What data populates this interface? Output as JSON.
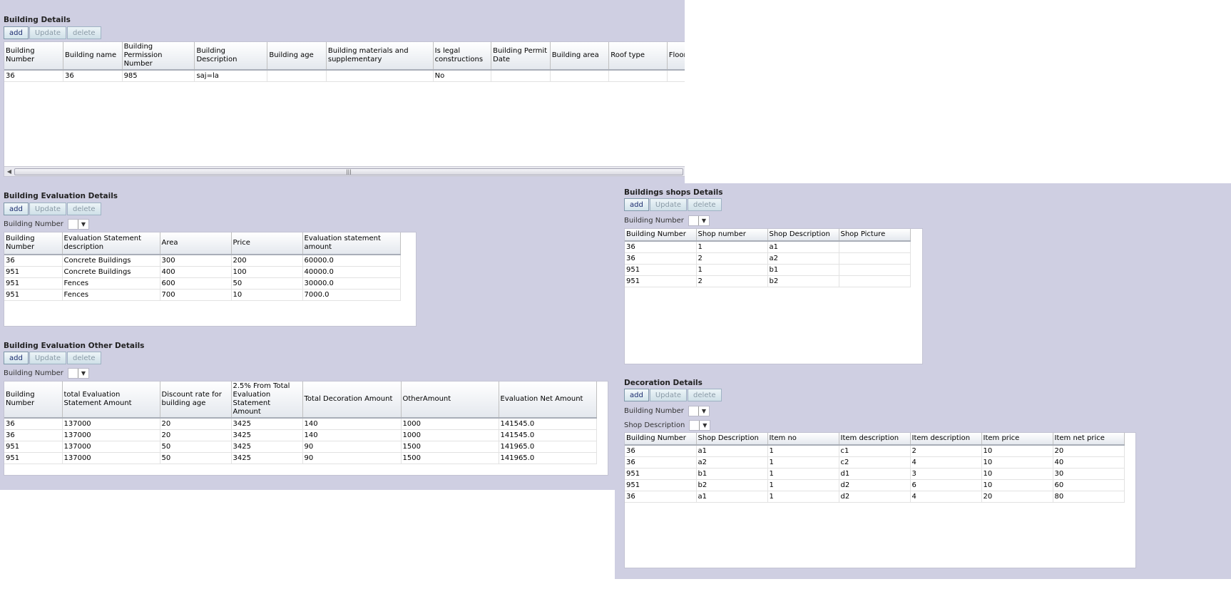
{
  "buttons": {
    "add": "add",
    "update": "Update",
    "delete": "delete"
  },
  "filter_labels": {
    "building_number": "Building Number",
    "shop_description": "Shop Description"
  },
  "building_details": {
    "title": "Building Details",
    "columns": [
      "Building Number",
      "Building name",
      "Building Permission Number",
      "Building Description",
      "Building age",
      "Building materials and supplementary",
      "Is legal constructions",
      "Building Permit Date",
      "Building area",
      "Roof type",
      "Floor type"
    ],
    "rows": [
      [
        "36",
        "36",
        "985",
        "saj=la",
        "",
        "",
        "No",
        "",
        "",
        "",
        ""
      ]
    ],
    "scrollbar_grip": "|||"
  },
  "evaluation_details": {
    "title": "Building Evaluation Details",
    "columns": [
      "Building Number",
      "Evaluation Statement description",
      "Area",
      "Price",
      "Evaluation statement amount"
    ],
    "rows": [
      [
        "36",
        "Concrete Buildings",
        "300",
        "200",
        "60000.0"
      ],
      [
        "951",
        "Concrete Buildings",
        "400",
        "100",
        "40000.0"
      ],
      [
        "951",
        "Fences",
        "600",
        "50",
        "30000.0"
      ],
      [
        "951",
        "Fences",
        "700",
        "10",
        "7000.0"
      ]
    ]
  },
  "evaluation_other": {
    "title": "Building Evaluation Other Details",
    "columns": [
      "Building Number",
      "total Evaluation Statement Amount",
      "Discount rate for building age",
      "2.5% From Total Evaluation Statement Amount",
      "Total Decoration Amount",
      "OtherAmount",
      "Evaluation Net Amount"
    ],
    "rows": [
      [
        "36",
        "137000",
        "20",
        "3425",
        "140",
        "1000",
        "141545.0"
      ],
      [
        "36",
        "137000",
        "20",
        "3425",
        "140",
        "1000",
        "141545.0"
      ],
      [
        "951",
        "137000",
        "50",
        "3425",
        "90",
        "1500",
        "141965.0"
      ],
      [
        "951",
        "137000",
        "50",
        "3425",
        "90",
        "1500",
        "141965.0"
      ]
    ]
  },
  "shops": {
    "title": "Buildings shops Details",
    "columns": [
      "Building Number",
      "Shop number",
      "Shop Description",
      "Shop Picture"
    ],
    "rows": [
      [
        "36",
        "1",
        "a1",
        ""
      ],
      [
        "36",
        "2",
        "a2",
        ""
      ],
      [
        "951",
        "1",
        "b1",
        ""
      ],
      [
        "951",
        "2",
        "b2",
        ""
      ]
    ]
  },
  "decoration": {
    "title": "Decoration Details",
    "columns": [
      "Building Number",
      "Shop Description",
      "Item no",
      "Item description",
      "Item description",
      "Item price",
      "Item net price"
    ],
    "rows": [
      [
        "36",
        "a1",
        "1",
        "c1",
        "2",
        "10",
        "20"
      ],
      [
        "36",
        "a2",
        "1",
        "c2",
        "4",
        "10",
        "40"
      ],
      [
        "951",
        "b1",
        "1",
        "d1",
        "3",
        "10",
        "30"
      ],
      [
        "951",
        "b2",
        "1",
        "d2",
        "6",
        "10",
        "60"
      ],
      [
        "36",
        "a1",
        "1",
        "d2",
        "4",
        "20",
        "80"
      ]
    ]
  }
}
